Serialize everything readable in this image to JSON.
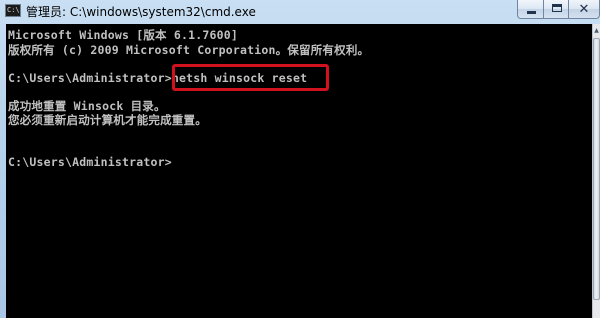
{
  "window": {
    "title": "管理员: C:\\windows\\system32\\cmd.exe",
    "icon_text": "C:\\",
    "close_symbol": "✕",
    "icons": {
      "app": "cmd-app-icon",
      "minimize": "minimize-icon",
      "maximize": "maximize-icon",
      "close": "close-icon"
    }
  },
  "console": {
    "lines": [
      "Microsoft Windows [版本 6.1.7600]",
      "版权所有 (c) 2009 Microsoft Corporation。保留所有权利。",
      "C:\\Users\\Administrator>netsh winsock reset",
      "成功地重置 Winsock 目录。",
      "您必须重新启动计算机才能完成重置。",
      "C:\\Users\\Administrator>"
    ],
    "text_color": "#c0c0c0",
    "background": "#000000",
    "highlight_color": "#d1111d"
  },
  "scrollbar": {
    "up_arrow": "▲"
  }
}
